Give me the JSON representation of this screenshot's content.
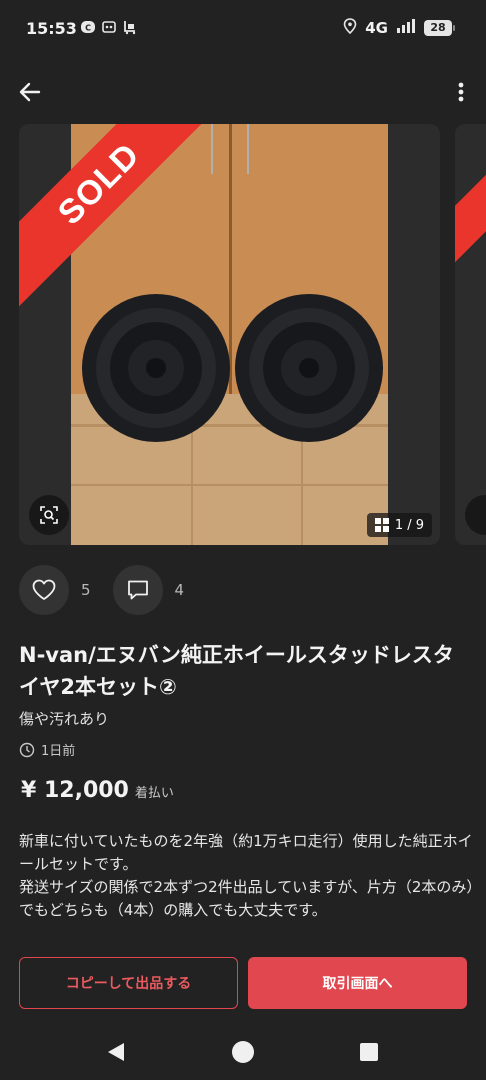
{
  "status": {
    "time": "15:53",
    "network": "4G",
    "battery": "28",
    "notification_icons": [
      "line-notification-icon",
      "game-icon",
      "shopping-icon"
    ]
  },
  "gallery": {
    "sold_label": "SOLD",
    "counter": "1 / 9"
  },
  "stats": {
    "likes": "5",
    "comments": "4"
  },
  "item": {
    "title": "N-van/エヌバン純正ホイールスタッドレスタイヤ2本セット②",
    "condition": "傷や汚れあり",
    "posted": "1日前",
    "price": "¥ 12,000",
    "shipping": "着払い",
    "description_lines": [
      "新車に付いていたものを2年強（約1万キロ走行）使用した純正ホイールセットです。",
      "発送サイズの関係で2本ずつ2件出品していますが、片方（2本のみ）でもどちらも（4本）の購入でも大丈夫です。"
    ]
  },
  "buttons": {
    "copy": "コピーして出品する",
    "trade": "取引画面へ"
  },
  "colors": {
    "background": "#222222",
    "accent": "#e0474f",
    "sold_ribbon": "#ea352d"
  }
}
